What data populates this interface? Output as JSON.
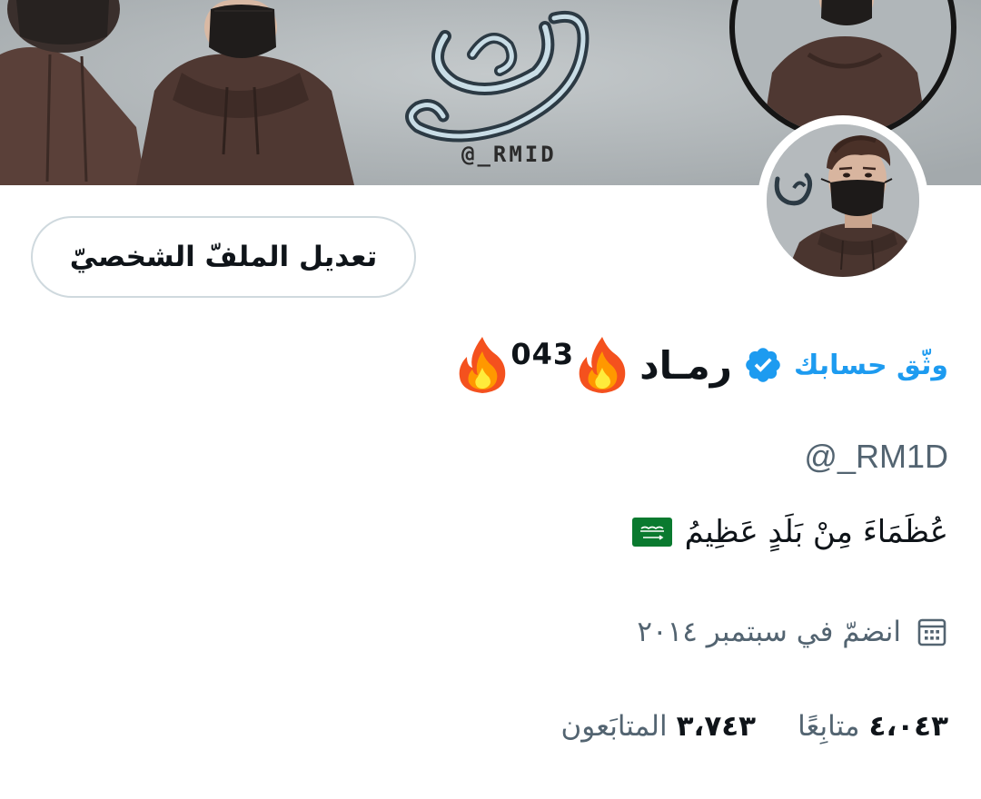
{
  "banner": {
    "watermark_handle": "@_RMID"
  },
  "profile": {
    "edit_button_label": "تعديل الملفّ الشخصيّ",
    "verify_link_label": "وثّق حسابك",
    "display_name_text": "رمـاد",
    "display_name_number": "043",
    "handle": "@_RM1D",
    "bio": "عُظَمَاءَ مِنْ بَلَدٍ عَظِيمُ",
    "bio_emoji": "saudi-flag",
    "joined": "انضمّ في سبتمبر ٢٠١٤"
  },
  "stats": {
    "followers_value": "٣،٧٤٣",
    "followers_label": "المتابَعون",
    "following_value": "٤،٠٤٣",
    "following_label": "متابِعًا"
  },
  "colors": {
    "accent": "#1d9bf0",
    "secondary_text": "#536471",
    "primary_text": "#0f1419",
    "border": "#cfd9de"
  }
}
